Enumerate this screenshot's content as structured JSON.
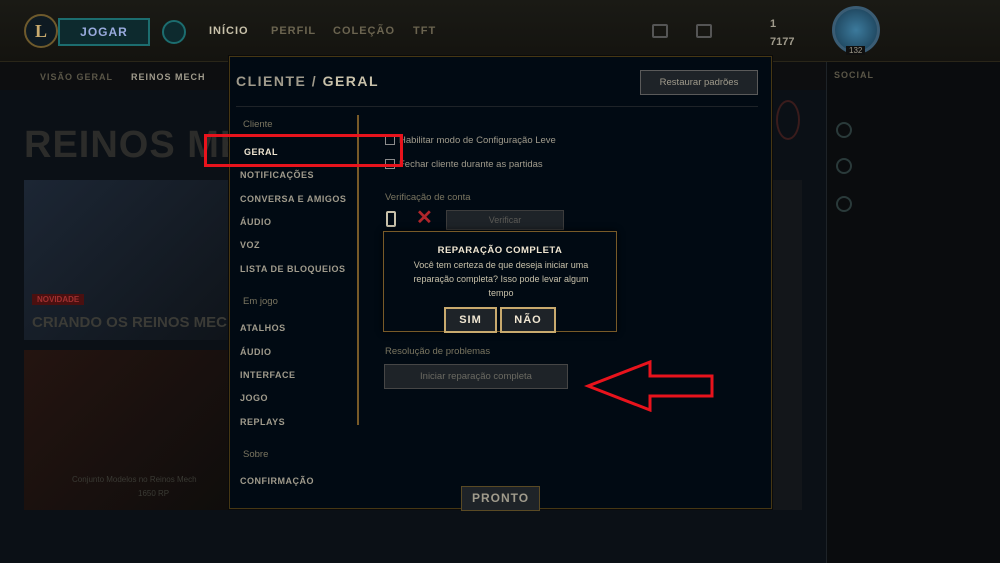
{
  "topbar": {
    "logo": "L",
    "play_label": "JOGAR",
    "nav": [
      "INÍCIO",
      "PERFIL",
      "COLEÇÃO",
      "TFT"
    ],
    "currency_rp": "1",
    "currency_be": "7177",
    "level": "132"
  },
  "subnav": [
    "VISÃO GERAL",
    "REINOS MECH"
  ],
  "social_title": "SOCIAL",
  "background": {
    "big_title": "REINOS MECH",
    "new_tag": "NOVIDADE",
    "banner_title": "CRIANDO OS REINOS MECH",
    "card2_text": "Conjunto Modelos no Reinos Mech",
    "card2_sub": "1650 RP"
  },
  "modal": {
    "title_prefix": "CLIENTE",
    "title_separator": "/",
    "title_current": "GERAL",
    "restore_label": "Restaurar padrões",
    "menu": {
      "group_client": "Cliente",
      "client_items": [
        "GERAL",
        "NOTIFICAÇÕES",
        "CONVERSA E AMIGOS",
        "ÁUDIO",
        "VOZ",
        "LISTA DE BLOQUEIOS"
      ],
      "group_ingame": "Em jogo",
      "ingame_items": [
        "ATALHOS",
        "ÁUDIO",
        "INTERFACE",
        "JOGO",
        "REPLAYS"
      ],
      "group_about": "Sobre",
      "about_items": [
        "CONFIRMAÇÃO"
      ]
    },
    "content": {
      "low_spec_label": "Habilitar modo de Configuração Leve",
      "close_client_label": "Fechar cliente durante as partidas",
      "verification_label": "Verificação de conta",
      "verify_button": "Verificar",
      "troubleshoot_label": "Resolução de problemas",
      "repair_button": "Iniciar reparação completa"
    },
    "done_label": "PRONTO"
  },
  "dialog": {
    "title": "REPARAÇÃO COMPLETA",
    "body": "Você tem certeza de que deseja iniciar uma reparação completa? Isso pode levar algum tempo",
    "yes_label": "SIM",
    "no_label": "NÃO"
  },
  "colors": {
    "gold": "#c8aa6e",
    "annotation_red": "#e8131c",
    "panel_bg": "#010a13"
  }
}
